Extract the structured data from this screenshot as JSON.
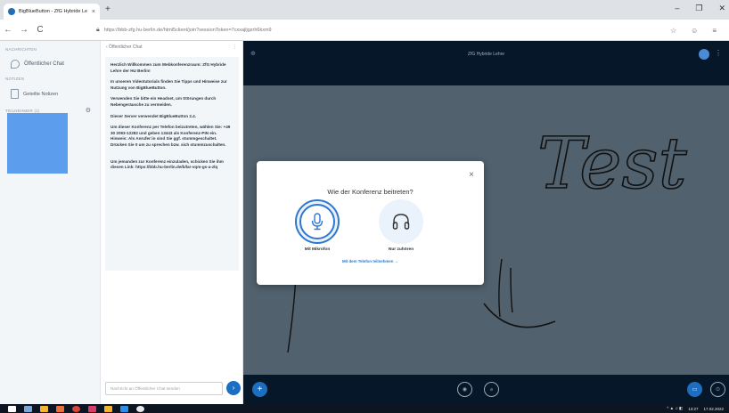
{
  "browser": {
    "tab_title": "BigBlueButton - ZfG Hybride Le",
    "tab_close": "×",
    "new_tab": "+",
    "window_controls": [
      "–",
      "❐",
      "✕"
    ],
    "nav": {
      "back": "←",
      "forward": "→",
      "reload": "C"
    },
    "url": "https://bbb-zfg.hu-berlin.de/html5client/join?sessionToken=7cxxajljgzrh6kxm9",
    "url_right_icons": [
      "☆",
      "☺",
      "≡"
    ]
  },
  "userlist": {
    "messages_title": "NACHRICHTEN",
    "public_chat": "Öffentlicher Chat",
    "notes_title": "NOTIZEN",
    "shared_notes": "Geteilte Notizen",
    "users_title": "TEILNEHMER (1)",
    "avatar_color": "#5c9ded"
  },
  "chat": {
    "header": "‹ Öffentlicher Chat",
    "header_menu": "⋮",
    "messages": [
      "Herzlich Willkommen zum Webkonferenzraum: ZfG Hybride Lehre der HU Berlin!",
      "In unseren Videotutorials finden Sie Tipps und Hinweise zur Nutzung von BigBlueButton.",
      "Verwenden Sie bitte ein Headset, um Störungen durch Nebengeräusche zu vermeiden.",
      "Dieser Server verwendet BigBlueButton 2.4.",
      "Um dieser Konferenz per Telefon beizutreten, wählen Sie: +49 30 2093-12282 und geben 13443 als Konferenz-PIN ein. Hinweis: Als Anrufer:in sind Sie ggf. stummgeschaltet. Drücken Sie 0 um zu sprechen bzw. sich stummzuschalten.",
      "Um jemanden zur Konferenz einzuladen, schicken Sie ihm diesen Link: https://bbb.hu-berlin.de/b/lar-vqm-gs-a-zlq"
    ],
    "input_placeholder": "Nachricht an Öffentlicher Chat senden",
    "send_icon": "›"
  },
  "stage": {
    "title": "ZfG Hybride Lehre",
    "left_icon": "⊕",
    "kebab": "⋮",
    "controls": {
      "plus": "+",
      "audio": "◉",
      "video": "⊘",
      "screen": "▭",
      "present": "⊙"
    },
    "whiteboard_color": "#51616e",
    "drawing_text": "Test"
  },
  "modal": {
    "title": "Wie der Konferenz beitreten?",
    "close": "×",
    "mic_label": "Mit Mikrofon",
    "listen_label": "Nur zuhören",
    "phone_link": "Mit dem Telefon teilnehmen →"
  },
  "taskbar": {
    "icons": [
      "#ffffff",
      "#7aa7d6",
      "#f3b632",
      "#e8703a",
      "#db4437",
      "#d63d6b",
      "#f6b32c",
      "#2f8de4",
      "#e8e8e8"
    ],
    "clock": "13:27",
    "date": "17.02.2022"
  }
}
